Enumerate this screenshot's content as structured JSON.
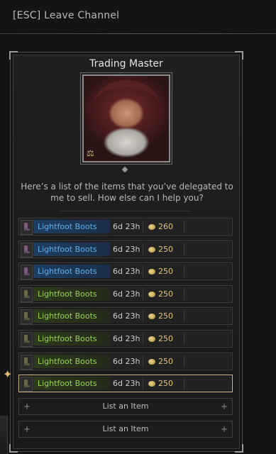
{
  "header": {
    "leave_label": "[ESC] Leave Channel"
  },
  "npc": {
    "title": "Trading Master",
    "greeting": "Here’s a list of the items that you’ve delegated to me to sell. How else can I help you?"
  },
  "listings": [
    {
      "name": "Lightfoot Boots",
      "rarity": "blue",
      "time": "6d 23h",
      "price": "260",
      "selected": false
    },
    {
      "name": "Lightfoot Boots",
      "rarity": "blue",
      "time": "6d 23h",
      "price": "250",
      "selected": false
    },
    {
      "name": "Lightfoot Boots",
      "rarity": "blue",
      "time": "6d 23h",
      "price": "250",
      "selected": false
    },
    {
      "name": "Lightfoot Boots",
      "rarity": "green",
      "time": "6d 23h",
      "price": "250",
      "selected": false
    },
    {
      "name": "Lightfoot Boots",
      "rarity": "green",
      "time": "6d 23h",
      "price": "250",
      "selected": false
    },
    {
      "name": "Lightfoot Boots",
      "rarity": "green",
      "time": "6d 23h",
      "price": "250",
      "selected": false
    },
    {
      "name": "Lightfoot Boots",
      "rarity": "green",
      "time": "6d 23h",
      "price": "250",
      "selected": false
    },
    {
      "name": "Lightfoot Boots",
      "rarity": "green",
      "time": "6d 23h",
      "price": "250",
      "selected": true
    }
  ],
  "actions": [
    {
      "label": "List an Item",
      "plus": "+"
    },
    {
      "label": "List an Item",
      "plus": "+"
    }
  ],
  "colors": {
    "rare": "#5fb1ee",
    "uncommon": "#9bd450",
    "gold": "#e0c47a"
  }
}
